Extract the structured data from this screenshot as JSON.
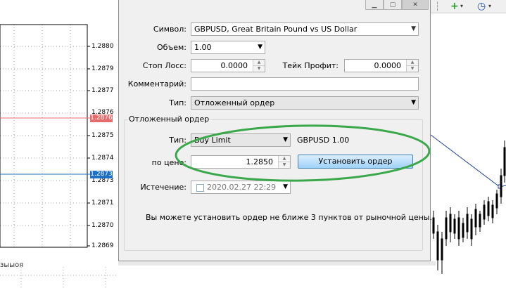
{
  "chart_left": {
    "price_labels": [
      "1.2880",
      "1.2879",
      "1.2877",
      "1.2876",
      "1.2875",
      "1.2874",
      "1.2873",
      "1.2871",
      "1.2870",
      "1.2869"
    ],
    "bid_badge": "1.2876",
    "ask_badge": "1.2873",
    "bid_color": "#e86b6b",
    "ask_color": "#1e6fc6",
    "bottom_text": "зыыоя"
  },
  "dialog": {
    "symbol_label": "Символ:",
    "symbol_value": "GBPUSD, Great Britain Pound vs US Dollar",
    "volume_label": "Объем:",
    "volume_value": "1.00",
    "stop_loss_label": "Стоп Лосс:",
    "stop_loss_value": "0.0000",
    "take_profit_label": "Тейк Профит:",
    "take_profit_value": "0.0000",
    "comment_label": "Комментарий:",
    "comment_value": "",
    "type_label": "Тип:",
    "type_value": "Отложенный ордер",
    "pending": {
      "group_title": "Отложенный ордер",
      "type_label": "Тип:",
      "type_value": "Buy Limit",
      "symbol_volume": "GBPUSD 1.00",
      "price_label": "по цене:",
      "price_value": "1.2850",
      "place_button": "Установить ордер",
      "expiration_label": "Истечение:",
      "expiration_value": "2020.02.27 22:29"
    },
    "notice": "Вы можете установить ордер не ближе 3 пунктов от рыночной цены."
  },
  "colors": {
    "highlight": "#3aa84a",
    "accent_button": "#9fd1f7"
  }
}
